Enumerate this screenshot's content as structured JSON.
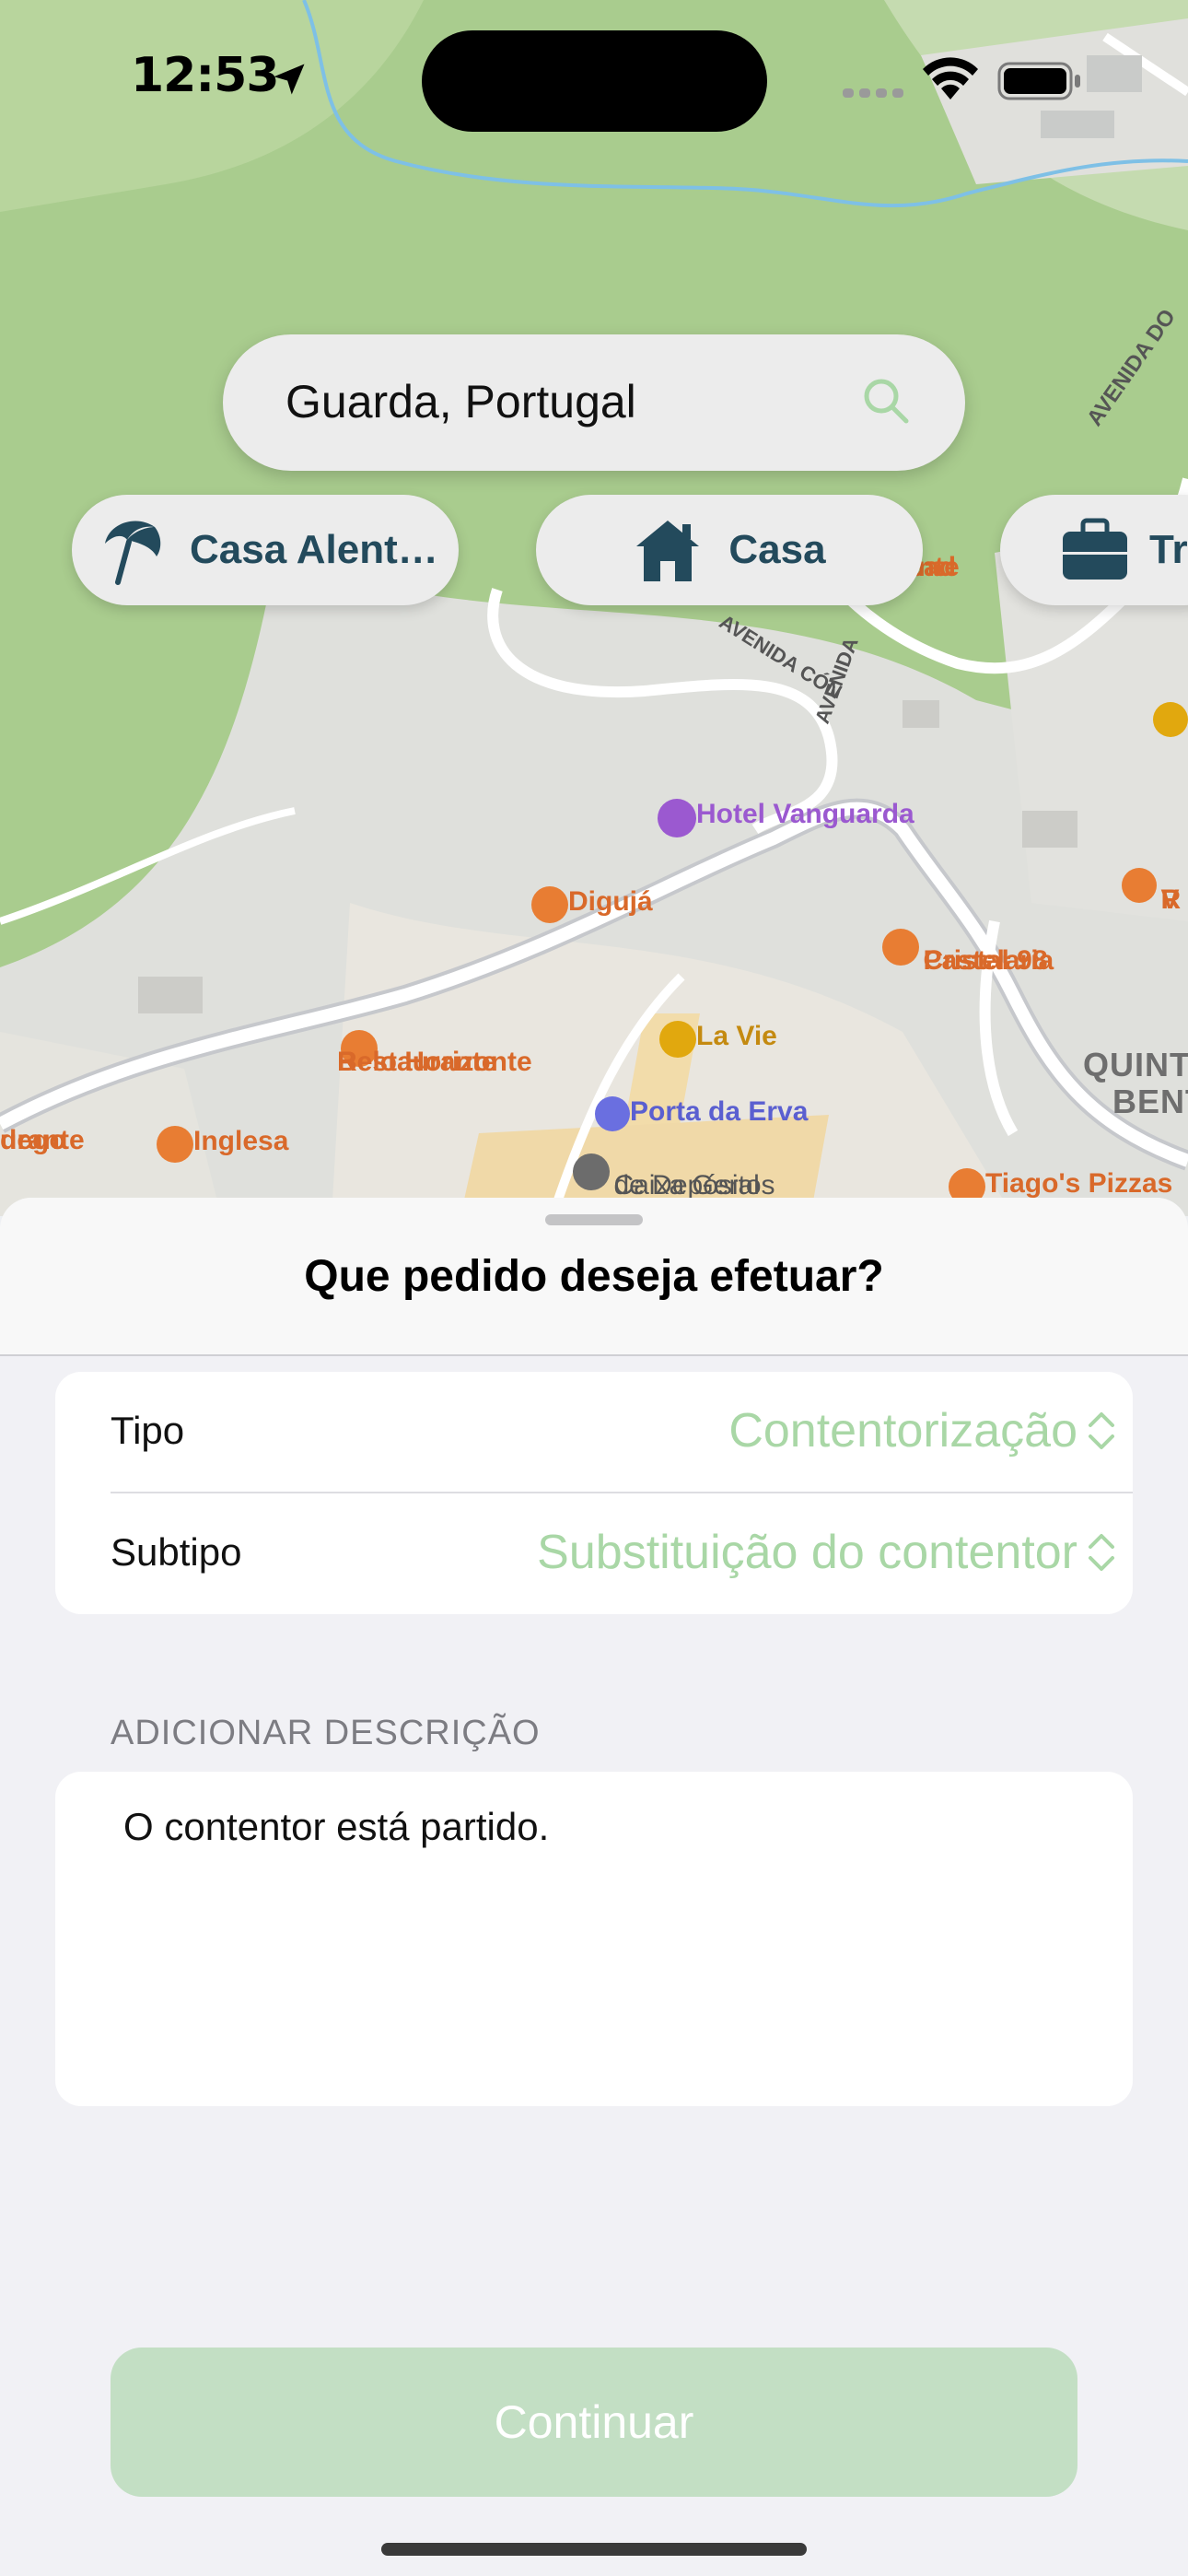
{
  "status_bar": {
    "time": "12:53"
  },
  "search": {
    "value": "Guarda, Portugal"
  },
  "favorites": [
    {
      "label": "Casa Alent…",
      "icon": "beach-umbrella-icon"
    },
    {
      "label": "Casa",
      "icon": "house-icon"
    },
    {
      "label": "Tr",
      "icon": "briefcase-icon"
    }
  ],
  "map": {
    "pois": [
      {
        "name": "Hotel Vanguarda",
        "color": "#9b59d0"
      },
      {
        "name": "Digujá",
        "color": "#d9692a"
      },
      {
        "name": "Pastelaria",
        "color": "#d9692a"
      },
      {
        "name": "Cristal 98",
        "color": "#d9692a"
      },
      {
        "name": "La Vie",
        "color": "#c48a10"
      },
      {
        "name": "Restaurante",
        "color": "#d9692a"
      },
      {
        "name": "Belo Horizonte",
        "color": "#d9692a"
      },
      {
        "name": "Porta da Erva",
        "color": "#5a5fd0"
      },
      {
        "name": "Inglesa",
        "color": "#d9692a"
      },
      {
        "name": "Caixa Geral",
        "color": "#555555"
      },
      {
        "name": "de Depósitos",
        "color": "#555555"
      },
      {
        "name": "Tiago's Pizzas",
        "color": "#d9692a"
      },
      {
        "name": "Mercad",
        "color": "#d9692a"
      },
      {
        "name": "Continente",
        "color": "#d9692a"
      },
      {
        "name": "urante",
        "color": "#d9692a"
      },
      {
        "name": "dego",
        "color": "#d9692a"
      },
      {
        "name": "R",
        "color": "#d9692a"
      },
      {
        "name": "V",
        "color": "#d9692a"
      }
    ],
    "areas": [
      {
        "name": "QUINTA"
      },
      {
        "name": "BENT"
      }
    ],
    "streets": [
      {
        "name": "AVENIDA DO"
      },
      {
        "name": "AVENIDA CÓN"
      },
      {
        "name": "AVENIDA"
      }
    ]
  },
  "sheet": {
    "title": "Que pedido deseja efetuar?",
    "fields": [
      {
        "label": "Tipo",
        "value": "Contentorização"
      },
      {
        "label": "Subtipo",
        "value": "Substituição do contentor"
      }
    ],
    "description_label": "ADICIONAR DESCRIÇÃO",
    "description_value": "O contentor está partido.",
    "continue_label": "Continuar"
  },
  "colors": {
    "accent_green": "#a9d7a6",
    "button_disabled": "#c3dfc4",
    "chip_text": "#234a5c",
    "map_park": "#a9cc8e"
  }
}
